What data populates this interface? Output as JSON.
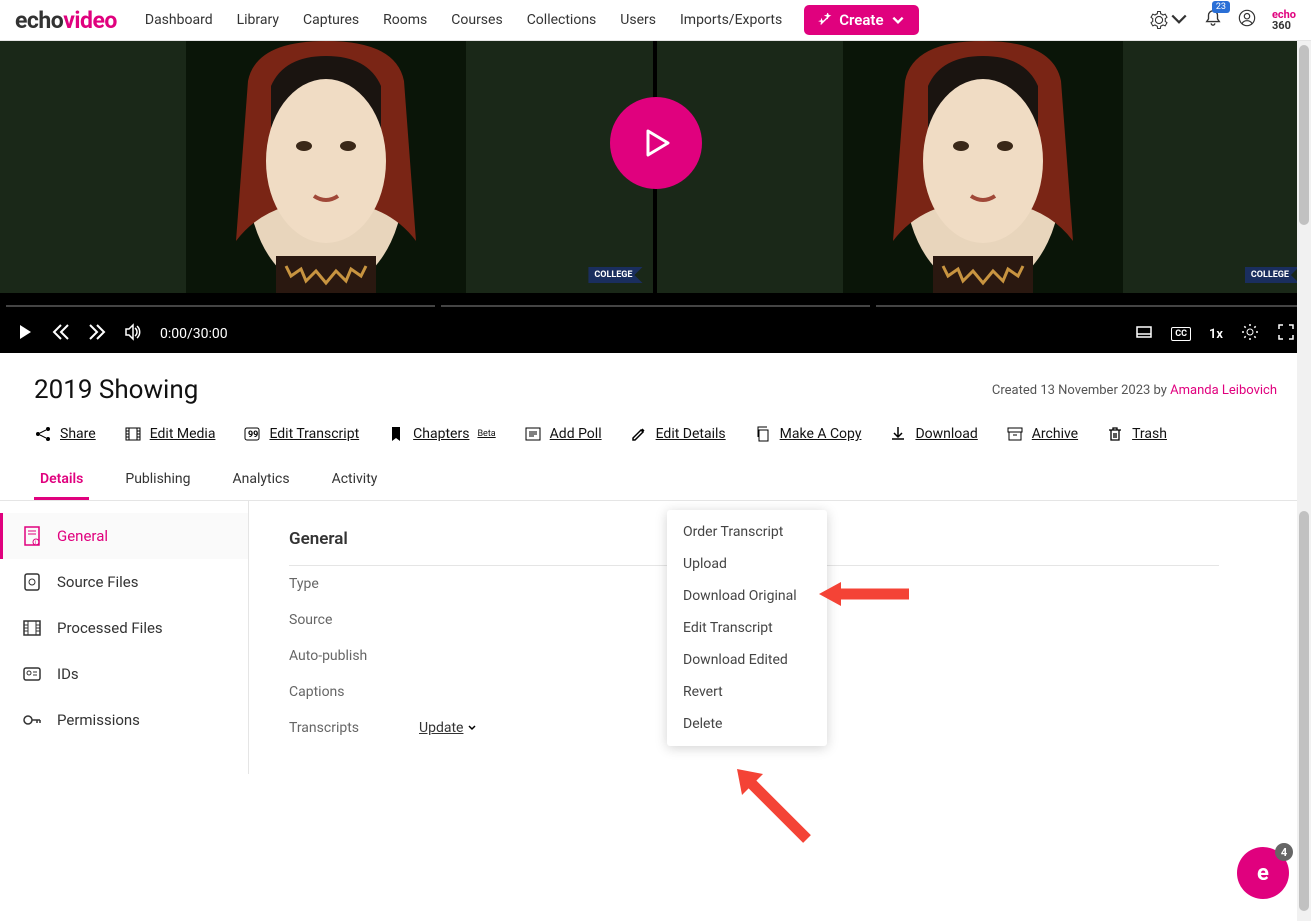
{
  "brand": {
    "echo": "echo",
    "video": "video"
  },
  "nav": [
    "Dashboard",
    "Library",
    "Captures",
    "Rooms",
    "Courses",
    "Collections",
    "Users",
    "Imports/Exports"
  ],
  "create_label": "Create",
  "notif_count": "23",
  "echo360_top": "echo",
  "echo360_bottom": "360",
  "video": {
    "flag": "COLLEGE",
    "time": "0:00/30:00",
    "speed": "1x",
    "cc": "CC"
  },
  "page_title": "2019 Showing",
  "meta_prefix": "Created 13 November 2023 by ",
  "meta_author": "Amanda Leibovich",
  "actions": {
    "share": "Share",
    "edit_media": "Edit Media",
    "edit_transcript": "Edit Transcript",
    "chapters": "Chapters",
    "chapters_badge": "Beta",
    "add_poll": "Add Poll",
    "edit_details": "Edit Details",
    "make_copy": "Make A Copy",
    "download": "Download",
    "archive": "Archive",
    "trash": "Trash"
  },
  "tabs": [
    "Details",
    "Publishing",
    "Analytics",
    "Activity"
  ],
  "sidebar": [
    "General",
    "Source Files",
    "Processed Files",
    "IDs",
    "Permissions"
  ],
  "section_title": "General",
  "fields": {
    "type": "Type",
    "source": "Source",
    "autopub": "Auto-publish",
    "captions": "Captions",
    "transcripts": "Transcripts",
    "update": "Update"
  },
  "dropdown": [
    "Order Transcript",
    "Upload",
    "Download Original",
    "Edit Transcript",
    "Download Edited",
    "Revert",
    "Delete"
  ],
  "chat_badge": "4"
}
